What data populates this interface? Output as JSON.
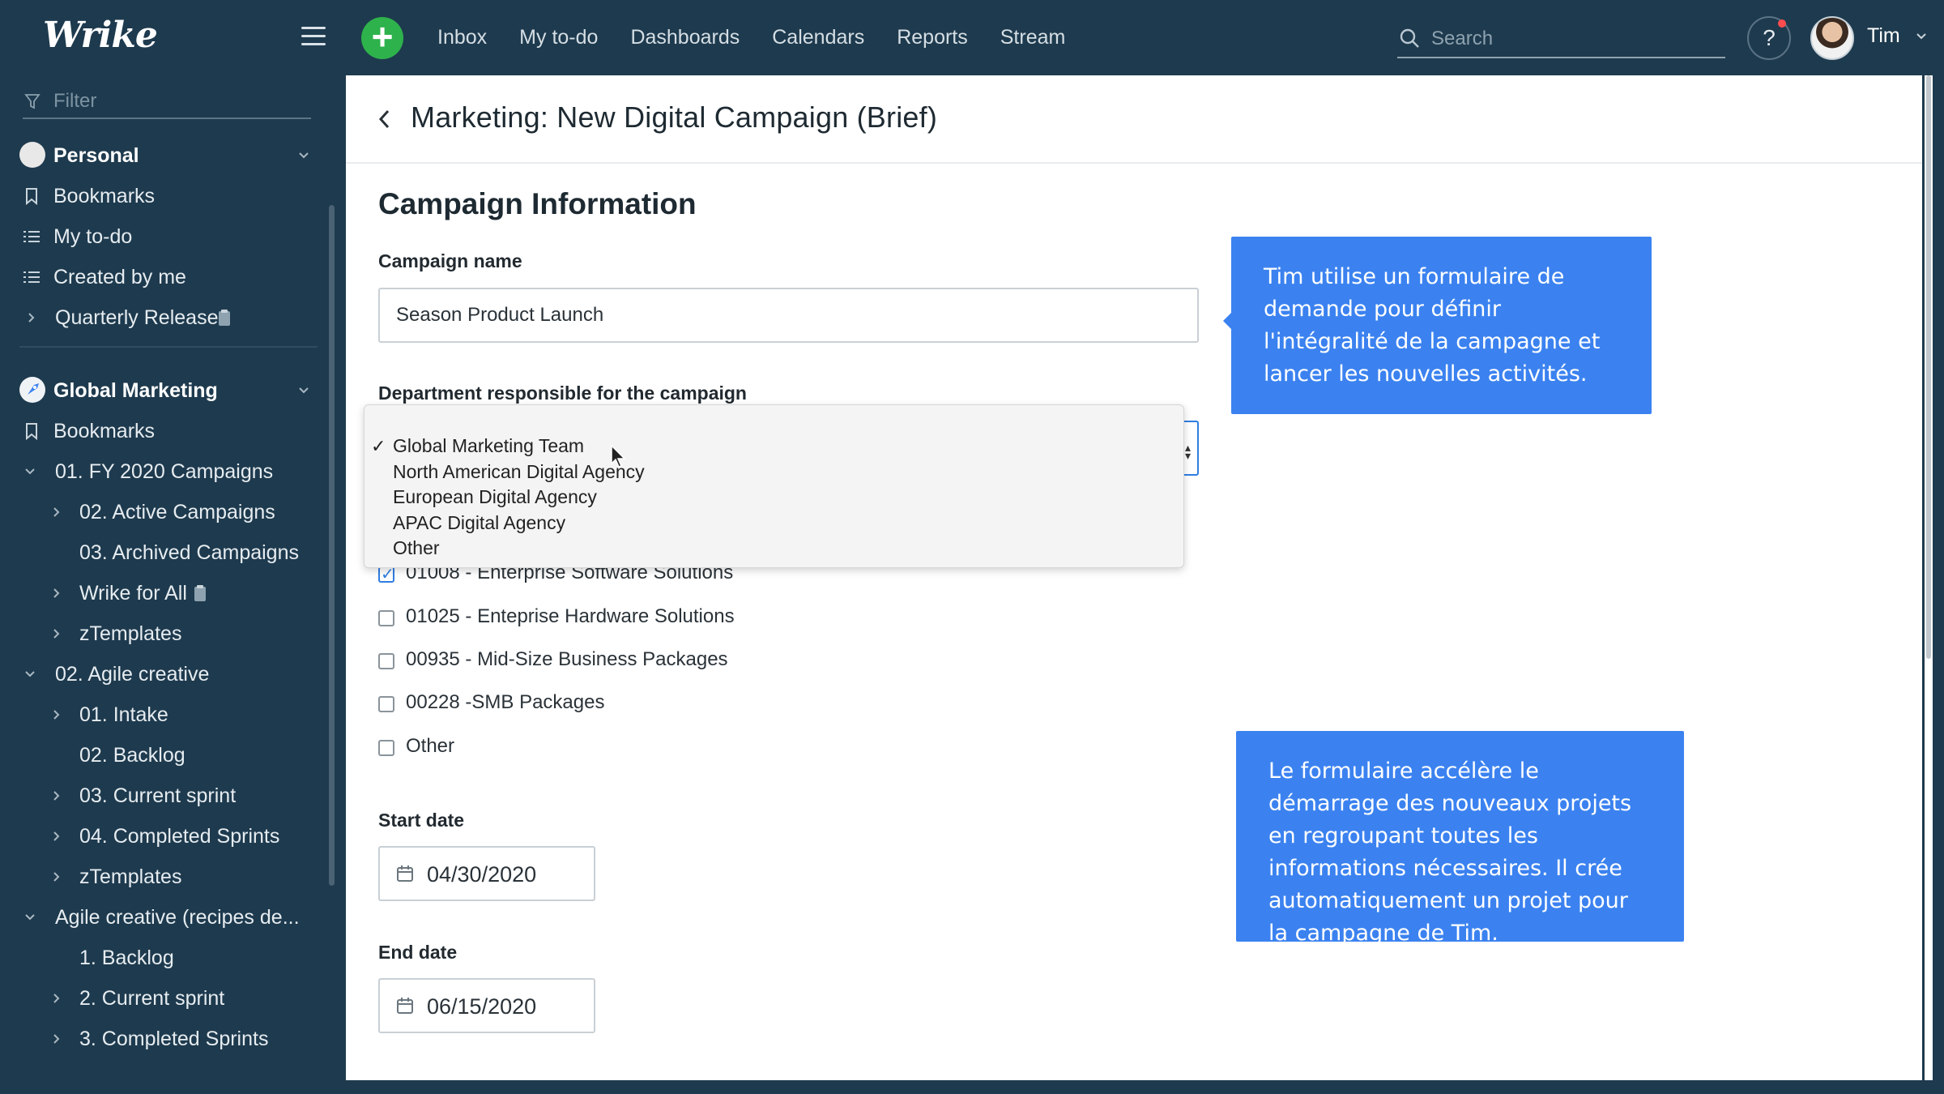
{
  "app": {
    "logo": "Wrike"
  },
  "topnav": {
    "items": [
      "Inbox",
      "My to-do",
      "Dashboards",
      "Calendars",
      "Reports",
      "Stream"
    ],
    "add_label": "+",
    "search_placeholder": "Search",
    "help_label": "?",
    "user_name": "Tim"
  },
  "sidebar": {
    "filter_placeholder": "Filter",
    "personal": {
      "title": "Personal",
      "items": [
        "Bookmarks",
        "My to-do",
        "Created by me",
        "Quarterly Release"
      ]
    },
    "global": {
      "title": "Global Marketing",
      "items": [
        "Bookmarks",
        "01. FY 2020 Campaigns",
        "02. Active Campaigns",
        "03. Archived Campaigns",
        "Wrike for All",
        "zTemplates",
        "02. Agile creative",
        "01. Intake",
        "02. Backlog",
        "03. Current sprint",
        "04. Completed Sprints",
        "zTemplates",
        "Agile creative (recipes de...",
        "1. Backlog",
        "2. Current sprint",
        "3. Completed Sprints"
      ]
    }
  },
  "main": {
    "title": "Marketing: New Digital Campaign (Brief)",
    "section": "Campaign Information",
    "campaign_name_label": "Campaign name",
    "campaign_name_value": "Season Product Launch",
    "department_label": "Department responsible for the campaign",
    "department_options": [
      "Global Marketing Team",
      "North American Digital Agency",
      "European Digital Agency",
      "APAC Digital Agency",
      "Other"
    ],
    "department_selected": "Global Marketing Team",
    "products": [
      {
        "label": "01008 - Enterprise Software Solutions",
        "checked": true
      },
      {
        "label": "01025 - Enteprise Hardware Solutions",
        "checked": false
      },
      {
        "label": "00935 - Mid-Size Business Packages",
        "checked": false
      },
      {
        "label": "00228 -SMB Packages",
        "checked": false
      },
      {
        "label": "Other",
        "checked": false
      }
    ],
    "start_date_label": "Start date",
    "start_date_value": "04/30/2020",
    "end_date_label": "End date",
    "end_date_value": "06/15/2020"
  },
  "callouts": {
    "first": "Tim utilise un formulaire de demande pour définir l'intégralité de la campagne et lancer les nouvelles activités.",
    "second": "Le formulaire accélère le démarrage des nouveaux projets en regroupant toutes les informations nécessaires. Il crée automatiquement un projet pour la campagne de Tim."
  },
  "colors": {
    "sidebar_bg": "#1e3a4e",
    "accent": "#3b82f0",
    "add_button": "#2eb24c",
    "select_focus": "#2f7de1"
  }
}
